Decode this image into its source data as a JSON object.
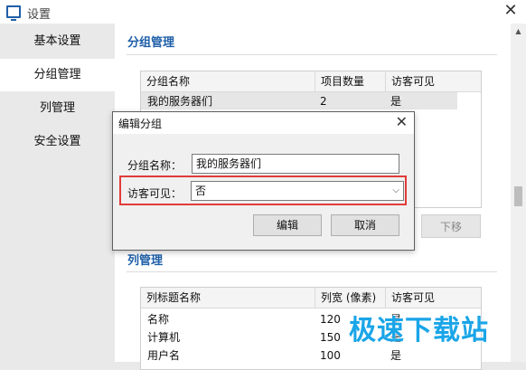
{
  "window": {
    "title": "设置"
  },
  "sidebar": {
    "items": [
      {
        "label": "基本设置"
      },
      {
        "label": "分组管理"
      },
      {
        "label": "列管理"
      },
      {
        "label": "安全设置"
      }
    ]
  },
  "groups_section": {
    "title": "分组管理",
    "columns": [
      "分组名称",
      "项目数量",
      "访客可见"
    ],
    "rows": [
      {
        "name": "我的服务器们",
        "count": "2",
        "visible": "是"
      }
    ],
    "down_button": "下移"
  },
  "columns_section": {
    "title": "列管理",
    "columns": [
      "列标题名称",
      "列宽 (像素)",
      "访客可见"
    ],
    "rows": [
      {
        "name": "名称",
        "width": "120",
        "visible": "是"
      },
      {
        "name": "计算机",
        "width": "150",
        "visible": "是"
      },
      {
        "name": "用户名",
        "width": "100",
        "visible": "是"
      }
    ]
  },
  "dialog": {
    "title": "编辑分组",
    "group_name_label": "分组名称：",
    "group_name_value": "我的服务器们",
    "visible_label": "访客可见：",
    "visible_value": "否",
    "edit_button": "编辑",
    "cancel_button": "取消"
  },
  "watermark": "极速下载站",
  "colors": {
    "accent": "#1f5fa8",
    "highlight": "#e23b3b",
    "watermark": "#1aa5e8"
  }
}
